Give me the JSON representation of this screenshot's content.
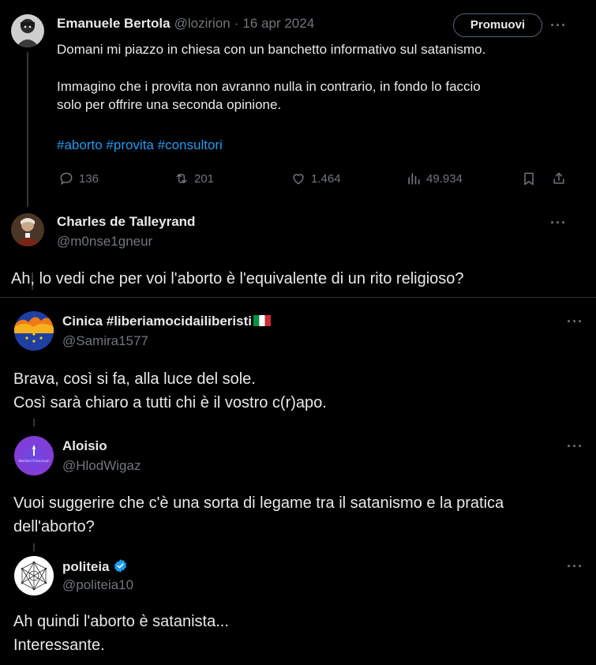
{
  "main_tweet": {
    "author_name": "Emanuele Bertola",
    "author_handle": "@lozirion",
    "separator": "·",
    "date": "16 apr 2024",
    "promote_label": "Promuovi",
    "more_label": "···",
    "line1": "Domani mi piazzo in chiesa con un banchetto informativo sul satanismo.",
    "line2": "Immagino che i provita non avranno nulla in contrario, in fondo lo faccio",
    "line3": "solo per offrire una seconda opinione.",
    "hashtags": [
      "#aborto",
      "#provita",
      "#consultori"
    ],
    "stats": {
      "replies": "136",
      "reposts": "201",
      "likes": "1.464",
      "views": "49.934"
    }
  },
  "replies": [
    {
      "name": "Charles de Talleyrand",
      "handle": "@m0nse1gneur",
      "more_label": "···",
      "lines": [
        "Ah, lo vedi che per voi l'aborto è l'equivalente di un rito religioso?"
      ]
    },
    {
      "name": "Cinica #liberiamocidailiberisti",
      "handle": "@Samira1577",
      "more_label": "···",
      "lines": [
        "Brava, così si fa, alla luce del sole.",
        "Così sarà chiaro a tutti chi è il vostro c(r)apo."
      ]
    },
    {
      "name": "Aloisio",
      "handle": "@HlodWigaz",
      "more_label": "···",
      "avatar_text": "Vexillum Francorum",
      "lines": [
        "Vuoi suggerire che c'è una sorta di legame tra il satanismo e la pratica",
        "dell'aborto?"
      ]
    },
    {
      "name": "politeia",
      "handle": "@politeia10",
      "more_label": "···",
      "lines": [
        "Ah quindi l'aborto è satanista...",
        "Interessante."
      ]
    }
  ],
  "colors": {
    "background": "#000000",
    "text": "#e7e9ea",
    "muted": "#71767b",
    "link": "#1d9bf0",
    "verified": "#1d9bf0",
    "border": "#2f3336"
  },
  "icons": [
    "reply-icon",
    "repost-icon",
    "like-icon",
    "views-icon",
    "bookmark-icon",
    "share-icon",
    "verified-badge-icon",
    "italy-flag-icon"
  ]
}
